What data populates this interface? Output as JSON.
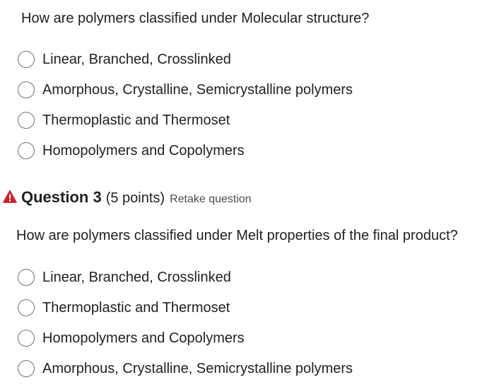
{
  "question2": {
    "prompt": "How are polymers classified under Molecular structure?",
    "options": [
      {
        "label": "Linear, Branched, Crosslinked",
        "selected": false
      },
      {
        "label": "Amorphous, Crystalline, Semicrystalline polymers",
        "selected": false
      },
      {
        "label": "Thermoplastic and Thermoset",
        "selected": false
      },
      {
        "label": "Homopolymers and Copolymers",
        "selected": false
      }
    ]
  },
  "question3": {
    "icon": "warning-icon",
    "warning_color": "#cd2026",
    "title": "Question 3",
    "points": "(5 points)",
    "retake": "Retake question",
    "prompt": "How are polymers classified under Melt properties of the final product?",
    "options": [
      {
        "label": "Linear, Branched, Crosslinked",
        "selected": false
      },
      {
        "label": "Thermoplastic and Thermoset",
        "selected": false
      },
      {
        "label": "Homopolymers and Copolymers",
        "selected": false
      },
      {
        "label": "Amorphous, Crystalline, Semicrystalline polymers",
        "selected": false
      }
    ]
  }
}
